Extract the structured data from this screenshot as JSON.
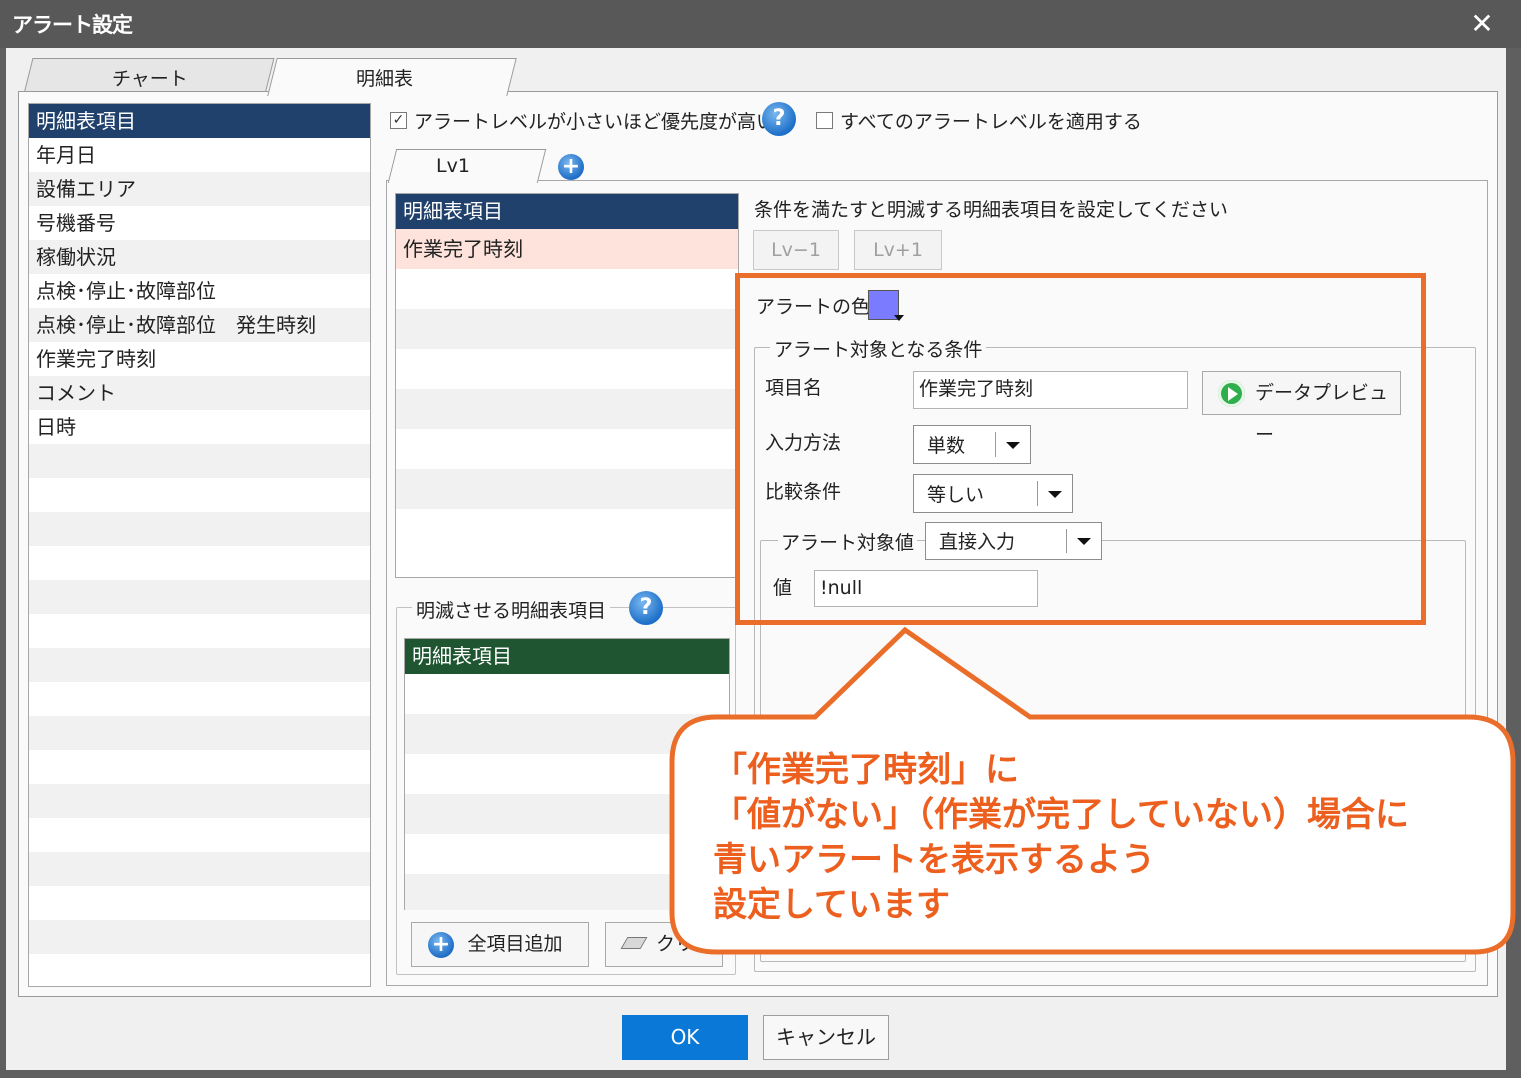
{
  "window": {
    "title": "アラート設定",
    "close_glyph": "✕"
  },
  "tabs": [
    {
      "label": "チャート",
      "active": false
    },
    {
      "label": "明細表",
      "active": true
    }
  ],
  "left_list": {
    "header": "明細表項目",
    "items": [
      "年月日",
      "設備エリア",
      "号機番号",
      "稼働状況",
      "点検･停止･故障部位",
      "点検･停止･故障部位　発生時刻",
      "作業完了時刻",
      "コメント",
      "日時"
    ]
  },
  "options": {
    "priority_checkbox_label": "アラートレベルが小さいほど優先度が高い",
    "priority_checked": true,
    "apply_all_label": "すべてのアラートレベルを適用する",
    "apply_all_checked": false
  },
  "level_tabs": {
    "active": "Lv1",
    "add_glyph": "+"
  },
  "conditions_list": {
    "header": "明細表項目",
    "items": [
      "作業完了時刻"
    ],
    "instruction": "条件を満たすと明滅する明細表項目を設定してください",
    "lv_minus_label": "Lv−1",
    "lv_plus_label": "Lv+1"
  },
  "alert_color": {
    "label": "アラートの色",
    "color": "#7b7bff"
  },
  "condition_group": {
    "legend": "アラート対象となる条件",
    "item_name_label": "項目名",
    "item_name_value": "作業完了時刻",
    "preview_label": "データプレビュー",
    "input_method_label": "入力方法",
    "input_method_value": "単数",
    "compare_label": "比較条件",
    "compare_value": "等しい",
    "target_value_legend": "アラート対象値",
    "target_value_mode": "直接入力",
    "value_label": "値",
    "value_text": "!null"
  },
  "blink_group": {
    "legend": "明滅させる明細表項目",
    "header": "明細表項目",
    "add_all_label": "全項目追加",
    "clear_label": "クリア"
  },
  "help_glyph": "?",
  "footer": {
    "ok_label": "OK",
    "cancel_label": "キャンセル"
  },
  "callout": {
    "lines": [
      "「作業完了時刻」に",
      "「値がない」（作業が完了していない）場合に",
      "青いアラートを表示するよう",
      "設定しています"
    ],
    "color": "#ec5f1f"
  }
}
